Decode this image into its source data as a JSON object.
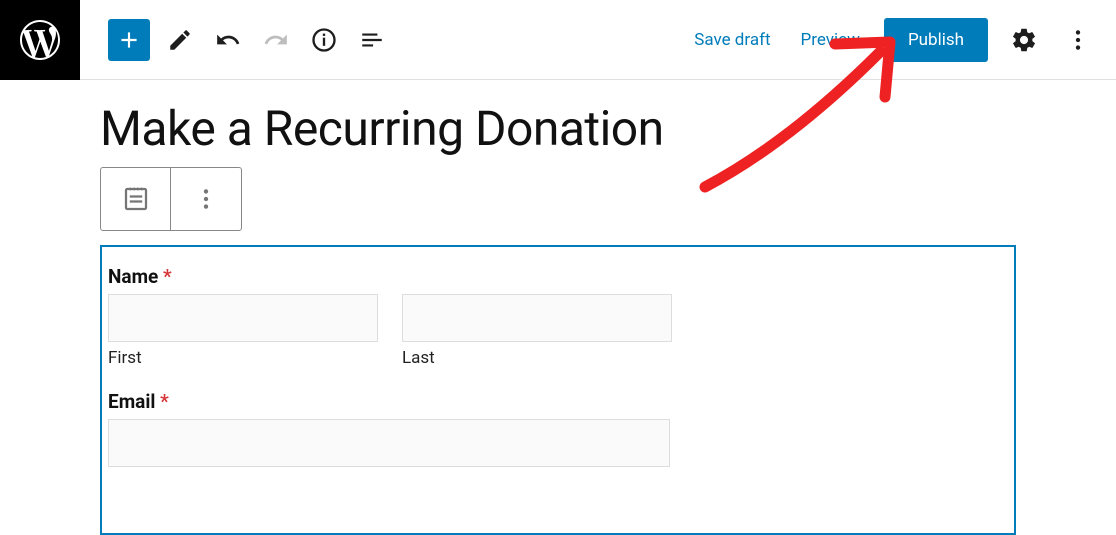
{
  "toolbar": {
    "save_draft": "Save draft",
    "preview": "Preview",
    "publish": "Publish"
  },
  "page": {
    "title": "Make a Recurring Donation"
  },
  "form": {
    "name_label": "Name",
    "name_required": "*",
    "first_sublabel": "First",
    "last_sublabel": "Last",
    "email_label": "Email",
    "email_required": "*"
  },
  "colors": {
    "primary": "#007cba",
    "danger": "#d63638"
  }
}
